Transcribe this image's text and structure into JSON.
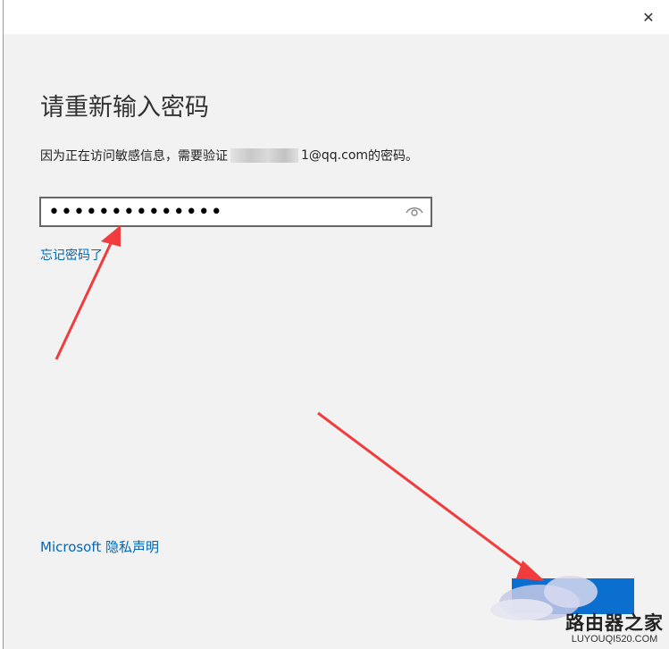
{
  "dialog": {
    "close_symbol": "✕",
    "heading": "请重新输入密码",
    "description_prefix": "因为正在访问敏感信息，需要验证",
    "description_email_suffix": "1@qq.com",
    "description_end": " 的密码。",
    "password_value": "••••••••••••••",
    "forgot_password_link": "忘记密码了",
    "privacy_link": "Microsoft 隐私声明"
  },
  "watermark": {
    "title": "路由器之家",
    "url": "LUYOUQI520.COM"
  },
  "colors": {
    "accent": "#0a6fcf",
    "link": "#0067b8",
    "annotation_arrow": "#f03c3c",
    "window_border": "#33c6c0"
  },
  "icons": [
    "close-icon",
    "eye-icon"
  ]
}
